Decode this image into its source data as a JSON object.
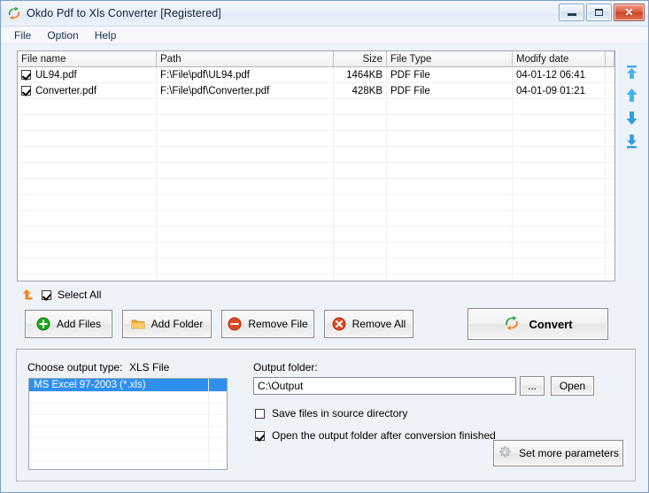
{
  "window": {
    "title": "Okdo Pdf to Xls Converter [Registered]",
    "app_icon": "convert-swirl-icon",
    "controls": {
      "minimize": "minimize-button",
      "maximize": "maximize-button",
      "close": "close-button",
      "close_glyph": "✕"
    }
  },
  "menu": {
    "items": [
      {
        "label": "File"
      },
      {
        "label": "Option"
      },
      {
        "label": "Help"
      }
    ]
  },
  "file_list": {
    "columns": [
      {
        "label": "File name",
        "align": "left"
      },
      {
        "label": "Path",
        "align": "left"
      },
      {
        "label": "Size",
        "align": "right"
      },
      {
        "label": "File Type",
        "align": "left"
      },
      {
        "label": "Modify date",
        "align": "left"
      },
      {
        "label": "",
        "align": "left"
      }
    ],
    "rows": [
      {
        "checked": true,
        "name": "UL94.pdf",
        "path": "F:\\File\\pdf\\UL94.pdf",
        "size": "1464KB",
        "type": "PDF File",
        "modified": "04-01-12 06:41"
      },
      {
        "checked": true,
        "name": "Converter.pdf",
        "path": "F:\\File\\pdf\\Converter.pdf",
        "size": "428KB",
        "type": "PDF File",
        "modified": "04-01-09 01:21"
      }
    ],
    "empty_row_count": 13
  },
  "order_buttons": [
    {
      "name": "move-to-top-icon"
    },
    {
      "name": "move-up-icon"
    },
    {
      "name": "move-down-icon"
    },
    {
      "name": "move-to-bottom-icon"
    }
  ],
  "select_all": {
    "label": "Select All",
    "checked": true,
    "icon": "orange-up-arrow-icon"
  },
  "toolbar": {
    "add_files": "Add Files",
    "add_folder": "Add Folder",
    "remove_file": "Remove File",
    "remove_all": "Remove All",
    "convert": "Convert"
  },
  "output": {
    "choose_output_type_label": "Choose output type:",
    "output_type_value": "XLS File",
    "type_options": [
      "MS Excel 97-2003 (*.xls)"
    ],
    "selected_type": "MS Excel 97-2003 (*.xls)",
    "output_folder_label": "Output folder:",
    "output_folder_value": "C:\\Output",
    "output_folder_placeholder": "",
    "browse_label": "...",
    "open_label": "Open",
    "save_in_source_label": "Save files in source directory",
    "save_in_source_checked": false,
    "open_after_label": "Open the output folder after conversion finished",
    "open_after_checked": true,
    "set_more_parameters": "Set more parameters"
  },
  "colors": {
    "accent_blue": "#2f8fef",
    "arrow_blue": "#2fa8e8",
    "add_green": "#23a61f",
    "folder_orange": "#f0a12a",
    "remove_red": "#e04a22",
    "close_red": "#cf4228"
  }
}
